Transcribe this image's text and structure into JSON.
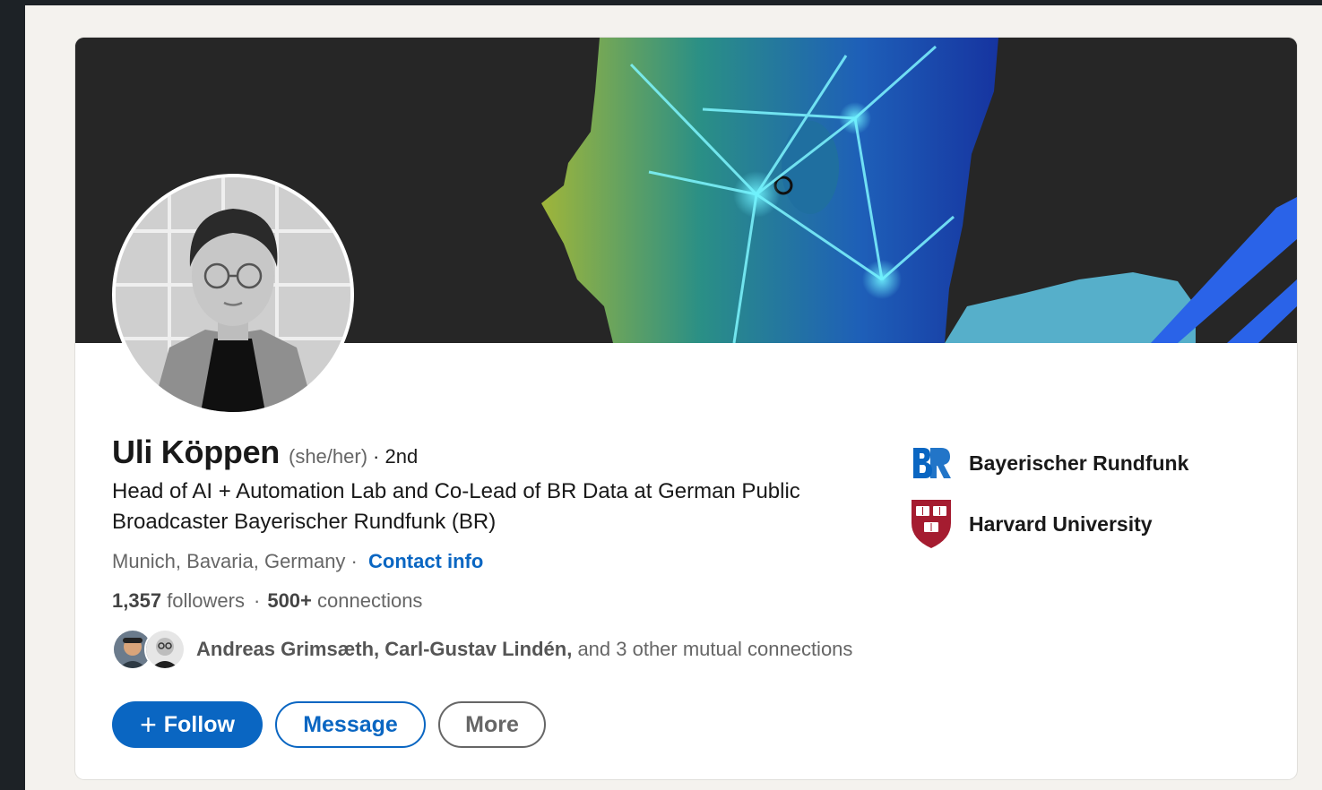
{
  "profile": {
    "name": "Uli Köppen",
    "pronouns": "(she/her)",
    "degree": "· 2nd",
    "headline": "Head of AI + Automation Lab and Co-Lead of BR Data at German Public Broadcaster Bayerischer Rundfunk (BR)",
    "location": "Munich, Bavaria, Germany ·",
    "contact_label": "Contact info",
    "followers_count": "1,357",
    "followers_label": "followers",
    "connections_count": "500+",
    "connections_label": "connections",
    "mutual_names": "Andreas Grimsæth, Carl-Gustav Lindén,",
    "mutual_rest": "and 3 other mutual connections"
  },
  "actions": {
    "follow_label": "Follow",
    "message_label": "Message",
    "more_label": "More"
  },
  "orgs": [
    {
      "name": "Bayerischer Rundfunk",
      "logo": "br-logo"
    },
    {
      "name": "Harvard University",
      "logo": "harvard-shield"
    }
  ],
  "colors": {
    "accent": "#0a66c2",
    "banner_bg": "#262626",
    "page_bg": "#f4f2ee"
  }
}
